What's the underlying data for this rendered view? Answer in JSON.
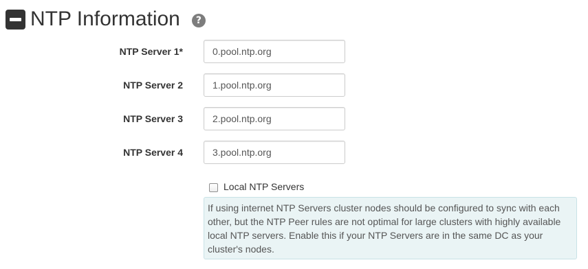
{
  "section": {
    "title": "NTP Information",
    "collapse_icon": "minus-square-icon",
    "help_icon": "question-circle-icon",
    "help_glyph": "?"
  },
  "fields": [
    {
      "label": "NTP Server 1*",
      "value": "0.pool.ntp.org"
    },
    {
      "label": "NTP Server 2",
      "value": "1.pool.ntp.org"
    },
    {
      "label": "NTP Server 3",
      "value": "2.pool.ntp.org"
    },
    {
      "label": "NTP Server 4",
      "value": "3.pool.ntp.org"
    }
  ],
  "local_ntp": {
    "label": "Local NTP Servers",
    "checked": false,
    "help_text": "If using internet NTP Servers cluster nodes should be configured to sync with each other, but the NTP Peer rules are not optimal for large clusters with highly available local NTP servers. Enable this if your NTP Servers are in the same DC as your cluster's nodes."
  },
  "colors": {
    "text": "#333333",
    "help_icon_bg": "#7d7d7d",
    "info_bg": "#eaf4f5",
    "info_border": "#c8e2e6",
    "input_border": "#cccccc"
  }
}
